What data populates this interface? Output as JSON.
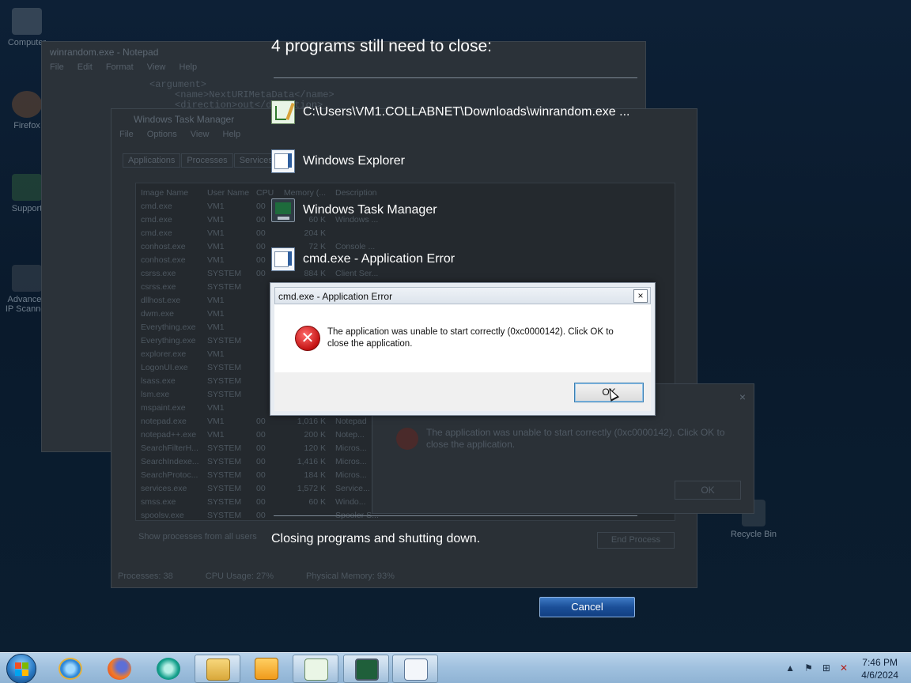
{
  "desktop": {
    "icons": [
      {
        "label": "Computer"
      },
      {
        "label": "Firefox"
      },
      {
        "label": "Support"
      },
      {
        "label": "Advanced IP Scanner"
      }
    ],
    "recycle_bin": "Recycle Bin"
  },
  "background": {
    "notepad_title": "winrandom.exe - Notepad",
    "notepad_menu": [
      "File",
      "Edit",
      "Format",
      "View",
      "Help"
    ],
    "notepad_lines": [
      "<argument>",
      "<name>NextURIMetaData</name>",
      "<direction>out</direction>"
    ],
    "task_manager": {
      "title": "Windows Task Manager",
      "menu": [
        "File",
        "Options",
        "View",
        "Help"
      ],
      "tabs": [
        "Applications",
        "Processes",
        "Services"
      ],
      "columns": [
        "Image Name",
        "User Name",
        "CPU",
        "Memory (...",
        "Description"
      ],
      "rows": [
        [
          "cmd.exe",
          "VM1",
          "00",
          "",
          ""
        ],
        [
          "cmd.exe",
          "VM1",
          "00",
          "60 K",
          "Windows ..."
        ],
        [
          "cmd.exe",
          "VM1",
          "00",
          "204 K",
          ""
        ],
        [
          "conhost.exe",
          "VM1",
          "00",
          "72 K",
          "Console ..."
        ],
        [
          "conhost.exe",
          "VM1",
          "00",
          "",
          ""
        ],
        [
          "csrss.exe",
          "SYSTEM",
          "00",
          "884 K",
          "Client Ser..."
        ],
        [
          "csrss.exe",
          "SYSTEM",
          "",
          "",
          ""
        ],
        [
          "dllhost.exe",
          "VM1",
          "",
          "",
          ""
        ],
        [
          "dwm.exe",
          "VM1",
          "",
          "",
          ""
        ],
        [
          "Everything.exe",
          "VM1",
          "",
          "",
          ""
        ],
        [
          "Everything.exe",
          "SYSTEM",
          "",
          "",
          ""
        ],
        [
          "explorer.exe",
          "VM1",
          "",
          "",
          ""
        ],
        [
          "LogonUI.exe",
          "SYSTEM",
          "",
          "",
          ""
        ],
        [
          "lsass.exe",
          "SYSTEM",
          "",
          "",
          ""
        ],
        [
          "lsm.exe",
          "SYSTEM",
          "",
          "",
          ""
        ],
        [
          "mspaint.exe",
          "VM1",
          "",
          "",
          ""
        ],
        [
          "notepad.exe",
          "VM1",
          "00",
          "1,016 K",
          "Notepad"
        ],
        [
          "notepad++.exe",
          "VM1",
          "00",
          "200 K",
          "Notep..."
        ],
        [
          "SearchFilterH...",
          "SYSTEM",
          "00",
          "120 K",
          "Micros..."
        ],
        [
          "SearchIndexe...",
          "SYSTEM",
          "00",
          "1,416 K",
          "Micros..."
        ],
        [
          "SearchProtoc...",
          "SYSTEM",
          "00",
          "184 K",
          "Micros..."
        ],
        [
          "services.exe",
          "SYSTEM",
          "00",
          "1,572 K",
          "Service..."
        ],
        [
          "smss.exe",
          "SYSTEM",
          "00",
          "60 K",
          "Windo..."
        ],
        [
          "spoolsv.exe",
          "SYSTEM",
          "00",
          "",
          "Spooler S..."
        ]
      ],
      "show_all": "Show processes from all users",
      "end_process": "End Process",
      "status": [
        "Processes: 38",
        "CPU Usage: 27%",
        "Physical Memory: 93%"
      ]
    },
    "ghost_error": {
      "message": "The application was unable to start correctly (0xc0000142). Click OK to close the application.",
      "ok": "OK"
    }
  },
  "shutdown": {
    "heading": "4 programs still need to close:",
    "programs": [
      {
        "label": "C:\\Users\\VM1.COLLABNET\\Downloads\\winrandom.exe ...",
        "icon": "notepad-icon"
      },
      {
        "label": "Windows Explorer",
        "icon": "explorer-icon"
      },
      {
        "label": "Windows Task Manager",
        "icon": "task-manager-icon"
      },
      {
        "label": "cmd.exe - Application Error",
        "icon": "application-icon"
      }
    ],
    "status": "Closing programs and shutting down.",
    "cancel_label": "Cancel"
  },
  "error_dialog": {
    "title": "cmd.exe - Application Error",
    "close_glyph": "×",
    "message": "The application was unable to start correctly (0xc0000142). Click OK to close the application.",
    "ok_label": "OK",
    "icon_glyph": "✕"
  },
  "taskbar": {
    "apps": [
      "internet-explorer-icon",
      "firefox-icon",
      "green-app-icon",
      "file-explorer-icon",
      "media-player-icon",
      "notepad-icon",
      "task-manager-icon",
      "window-icon"
    ],
    "tray_glyphs": [
      "▲",
      "⚑",
      "⊞",
      "✕"
    ],
    "time": "7:46 PM",
    "date": "4/6/2024"
  },
  "colors": {
    "background": "#0d2036",
    "error_red": "#c41313",
    "cancel_blue": "#1b4f98",
    "taskbar": "#9fc0de"
  }
}
